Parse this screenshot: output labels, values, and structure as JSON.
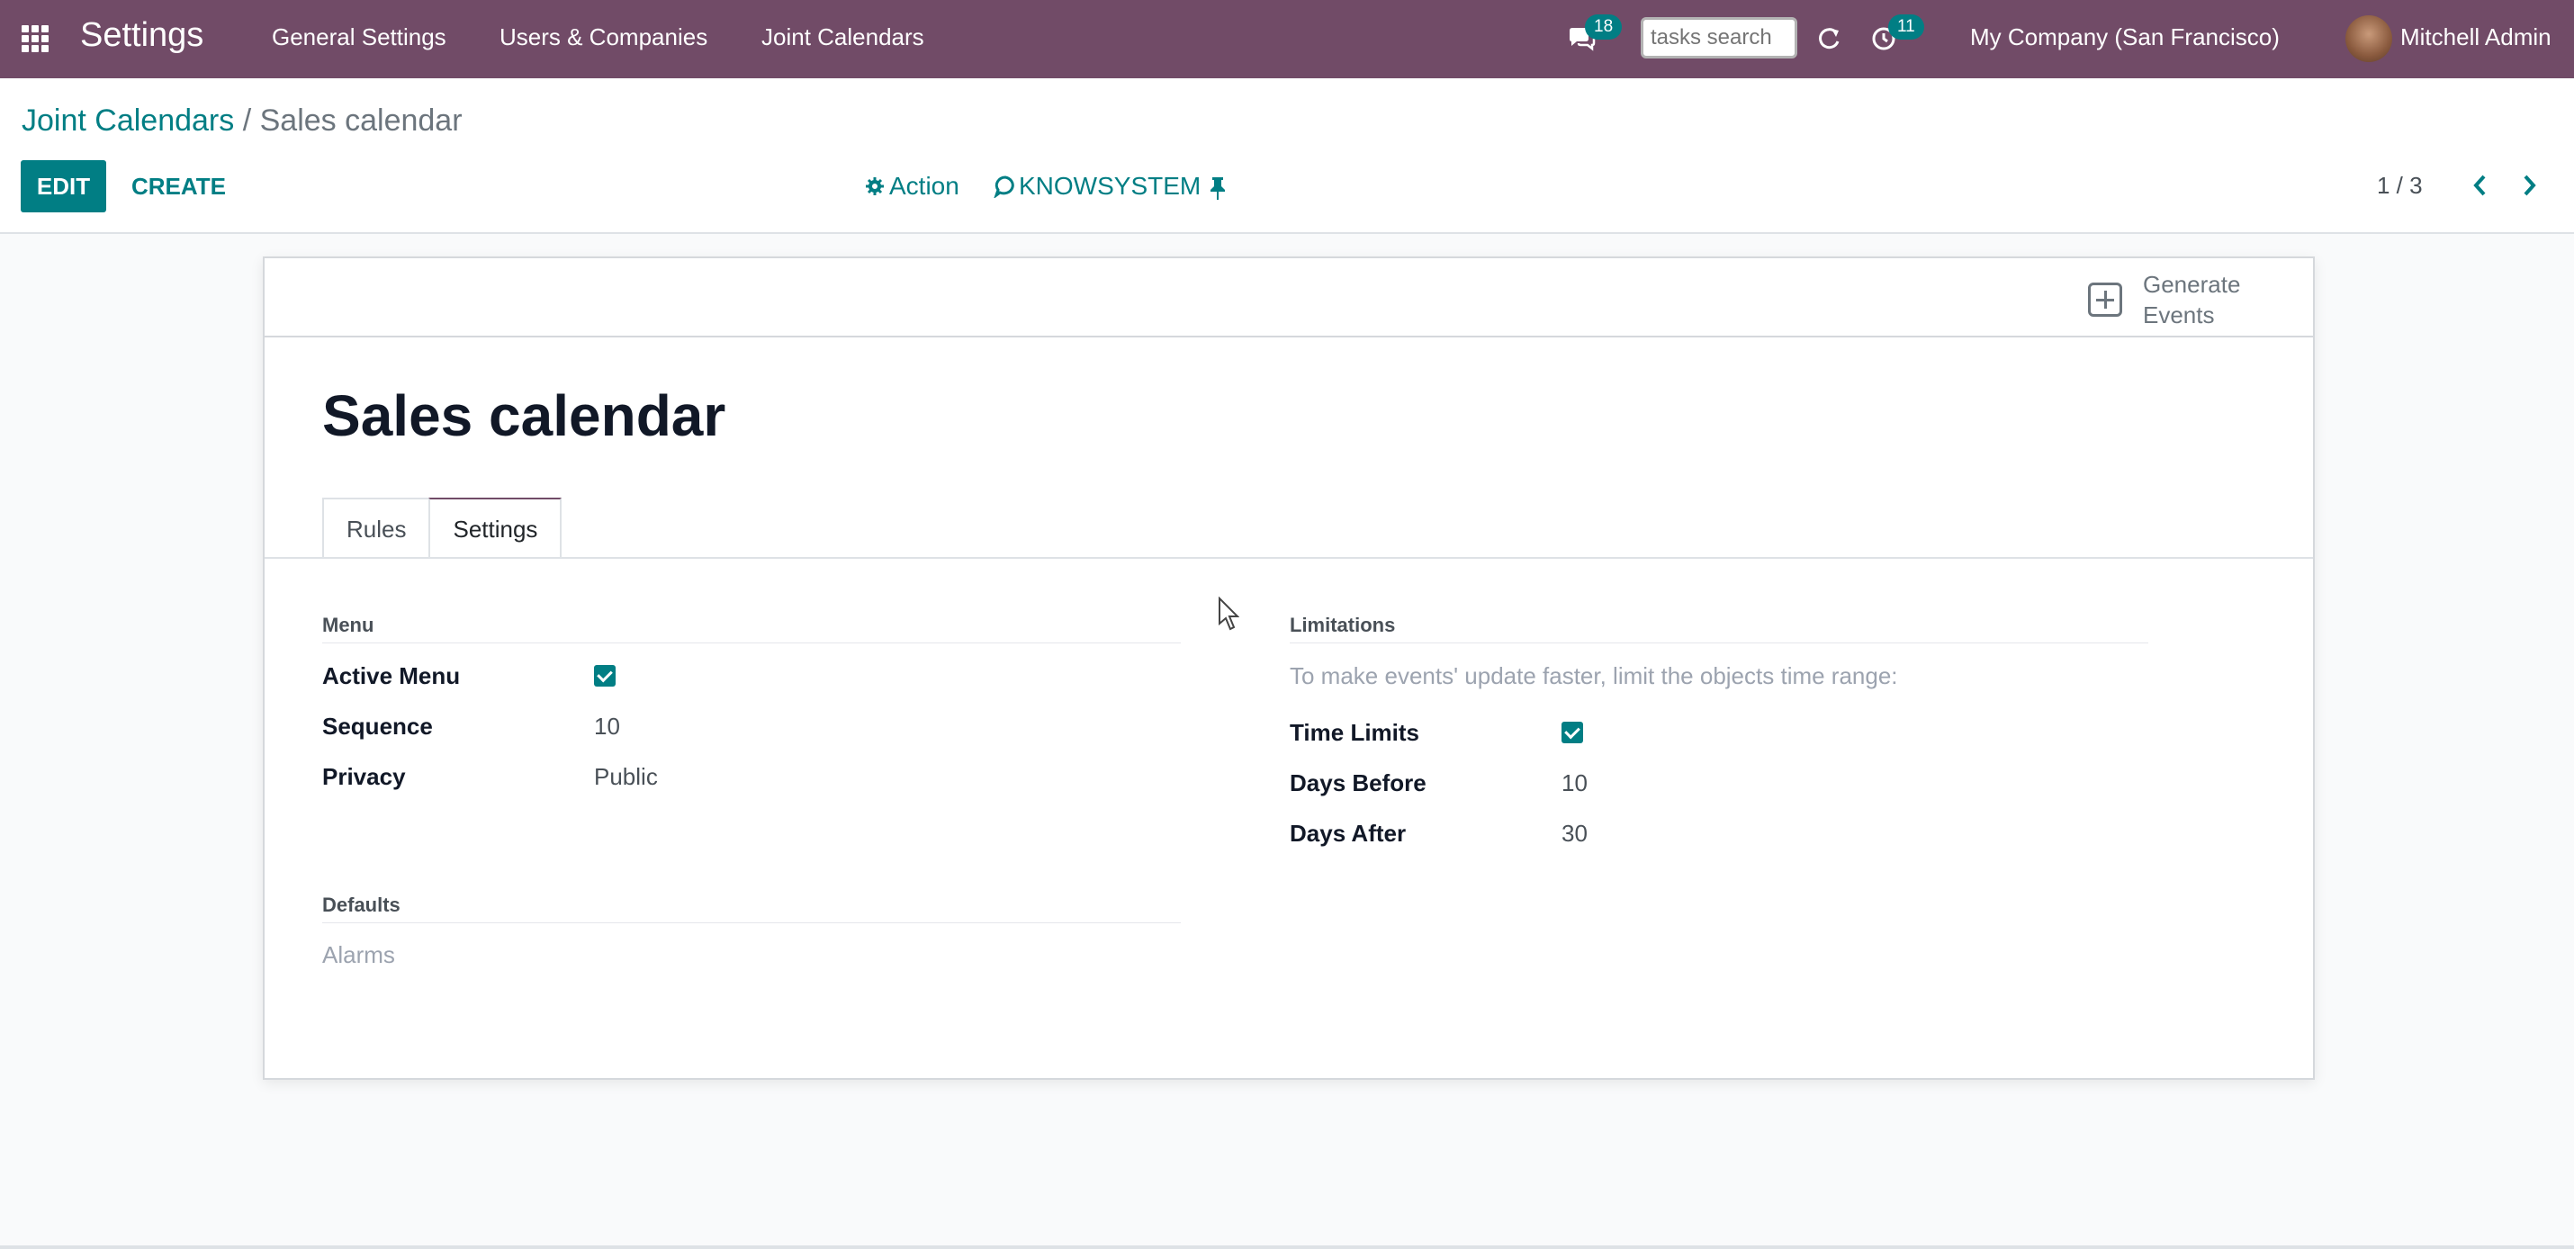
{
  "navbar": {
    "app_title": "Settings",
    "menu": [
      "General Settings",
      "Users & Companies",
      "Joint Calendars"
    ],
    "messages_count": "18",
    "search_placeholder": "tasks search",
    "activities_count": "11",
    "company": "My Company (San Francisco)",
    "user": "Mitchell Admin",
    "brand_color": "#714b67"
  },
  "breadcrumb": {
    "parent": "Joint Calendars",
    "separator": "/",
    "current": "Sales calendar"
  },
  "toolbar": {
    "edit_label": "EDIT",
    "create_label": "CREATE",
    "action_label": "Action",
    "knowsystem_label": "KNOWSYSTEM",
    "pager": "1 / 3"
  },
  "form": {
    "generate_events_label": "Generate Events",
    "title": "Sales calendar",
    "tabs": [
      "Rules",
      "Settings"
    ],
    "active_tab": "Settings",
    "menu_group": {
      "title": "Menu",
      "active_menu_label": "Active Menu",
      "active_menu_checked": true,
      "sequence_label": "Sequence",
      "sequence_value": "10",
      "privacy_label": "Privacy",
      "privacy_value": "Public"
    },
    "defaults_group": {
      "title": "Defaults",
      "alarms_label": "Alarms"
    },
    "limitations_group": {
      "title": "Limitations",
      "hint": "To make events' update faster, limit the objects time range:",
      "time_limits_label": "Time Limits",
      "time_limits_checked": true,
      "days_before_label": "Days Before",
      "days_before_value": "10",
      "days_after_label": "Days After",
      "days_after_value": "30"
    }
  },
  "accent_color": "#017e84"
}
